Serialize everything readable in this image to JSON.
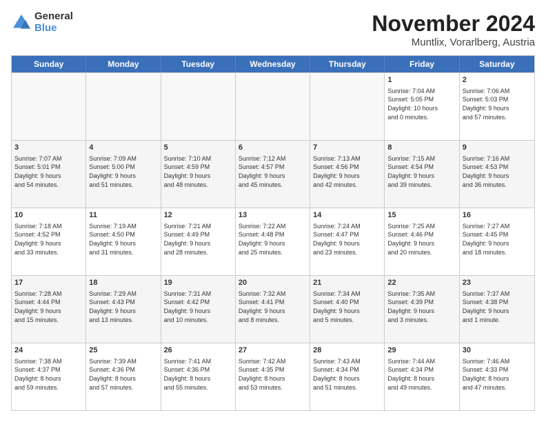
{
  "logo": {
    "general": "General",
    "blue": "Blue"
  },
  "title": "November 2024",
  "subtitle": "Muntlix, Vorarlberg, Austria",
  "days": [
    "Sunday",
    "Monday",
    "Tuesday",
    "Wednesday",
    "Thursday",
    "Friday",
    "Saturday"
  ],
  "weeks": [
    [
      {
        "date": "",
        "info": "",
        "empty": true
      },
      {
        "date": "",
        "info": "",
        "empty": true
      },
      {
        "date": "",
        "info": "",
        "empty": true
      },
      {
        "date": "",
        "info": "",
        "empty": true
      },
      {
        "date": "",
        "info": "",
        "empty": true
      },
      {
        "date": "1",
        "info": "Sunrise: 7:04 AM\nSunset: 5:05 PM\nDaylight: 10 hours\nand 0 minutes.",
        "empty": false
      },
      {
        "date": "2",
        "info": "Sunrise: 7:06 AM\nSunset: 5:03 PM\nDaylight: 9 hours\nand 57 minutes.",
        "empty": false
      }
    ],
    [
      {
        "date": "3",
        "info": "Sunrise: 7:07 AM\nSunset: 5:01 PM\nDaylight: 9 hours\nand 54 minutes.",
        "empty": false
      },
      {
        "date": "4",
        "info": "Sunrise: 7:09 AM\nSunset: 5:00 PM\nDaylight: 9 hours\nand 51 minutes.",
        "empty": false
      },
      {
        "date": "5",
        "info": "Sunrise: 7:10 AM\nSunset: 4:59 PM\nDaylight: 9 hours\nand 48 minutes.",
        "empty": false
      },
      {
        "date": "6",
        "info": "Sunrise: 7:12 AM\nSunset: 4:57 PM\nDaylight: 9 hours\nand 45 minutes.",
        "empty": false
      },
      {
        "date": "7",
        "info": "Sunrise: 7:13 AM\nSunset: 4:56 PM\nDaylight: 9 hours\nand 42 minutes.",
        "empty": false
      },
      {
        "date": "8",
        "info": "Sunrise: 7:15 AM\nSunset: 4:54 PM\nDaylight: 9 hours\nand 39 minutes.",
        "empty": false
      },
      {
        "date": "9",
        "info": "Sunrise: 7:16 AM\nSunset: 4:53 PM\nDaylight: 9 hours\nand 36 minutes.",
        "empty": false
      }
    ],
    [
      {
        "date": "10",
        "info": "Sunrise: 7:18 AM\nSunset: 4:52 PM\nDaylight: 9 hours\nand 33 minutes.",
        "empty": false
      },
      {
        "date": "11",
        "info": "Sunrise: 7:19 AM\nSunset: 4:50 PM\nDaylight: 9 hours\nand 31 minutes.",
        "empty": false
      },
      {
        "date": "12",
        "info": "Sunrise: 7:21 AM\nSunset: 4:49 PM\nDaylight: 9 hours\nand 28 minutes.",
        "empty": false
      },
      {
        "date": "13",
        "info": "Sunrise: 7:22 AM\nSunset: 4:48 PM\nDaylight: 9 hours\nand 25 minutes.",
        "empty": false
      },
      {
        "date": "14",
        "info": "Sunrise: 7:24 AM\nSunset: 4:47 PM\nDaylight: 9 hours\nand 23 minutes.",
        "empty": false
      },
      {
        "date": "15",
        "info": "Sunrise: 7:25 AM\nSunset: 4:46 PM\nDaylight: 9 hours\nand 20 minutes.",
        "empty": false
      },
      {
        "date": "16",
        "info": "Sunrise: 7:27 AM\nSunset: 4:45 PM\nDaylight: 9 hours\nand 18 minutes.",
        "empty": false
      }
    ],
    [
      {
        "date": "17",
        "info": "Sunrise: 7:28 AM\nSunset: 4:44 PM\nDaylight: 9 hours\nand 15 minutes.",
        "empty": false
      },
      {
        "date": "18",
        "info": "Sunrise: 7:29 AM\nSunset: 4:43 PM\nDaylight: 9 hours\nand 13 minutes.",
        "empty": false
      },
      {
        "date": "19",
        "info": "Sunrise: 7:31 AM\nSunset: 4:42 PM\nDaylight: 9 hours\nand 10 minutes.",
        "empty": false
      },
      {
        "date": "20",
        "info": "Sunrise: 7:32 AM\nSunset: 4:41 PM\nDaylight: 9 hours\nand 8 minutes.",
        "empty": false
      },
      {
        "date": "21",
        "info": "Sunrise: 7:34 AM\nSunset: 4:40 PM\nDaylight: 9 hours\nand 5 minutes.",
        "empty": false
      },
      {
        "date": "22",
        "info": "Sunrise: 7:35 AM\nSunset: 4:39 PM\nDaylight: 9 hours\nand 3 minutes.",
        "empty": false
      },
      {
        "date": "23",
        "info": "Sunrise: 7:37 AM\nSunset: 4:38 PM\nDaylight: 9 hours\nand 1 minute.",
        "empty": false
      }
    ],
    [
      {
        "date": "24",
        "info": "Sunrise: 7:38 AM\nSunset: 4:37 PM\nDaylight: 8 hours\nand 59 minutes.",
        "empty": false
      },
      {
        "date": "25",
        "info": "Sunrise: 7:39 AM\nSunset: 4:36 PM\nDaylight: 8 hours\nand 57 minutes.",
        "empty": false
      },
      {
        "date": "26",
        "info": "Sunrise: 7:41 AM\nSunset: 4:36 PM\nDaylight: 8 hours\nand 55 minutes.",
        "empty": false
      },
      {
        "date": "27",
        "info": "Sunrise: 7:42 AM\nSunset: 4:35 PM\nDaylight: 8 hours\nand 53 minutes.",
        "empty": false
      },
      {
        "date": "28",
        "info": "Sunrise: 7:43 AM\nSunset: 4:34 PM\nDaylight: 8 hours\nand 51 minutes.",
        "empty": false
      },
      {
        "date": "29",
        "info": "Sunrise: 7:44 AM\nSunset: 4:34 PM\nDaylight: 8 hours\nand 49 minutes.",
        "empty": false
      },
      {
        "date": "30",
        "info": "Sunrise: 7:46 AM\nSunset: 4:33 PM\nDaylight: 8 hours\nand 47 minutes.",
        "empty": false
      }
    ]
  ]
}
